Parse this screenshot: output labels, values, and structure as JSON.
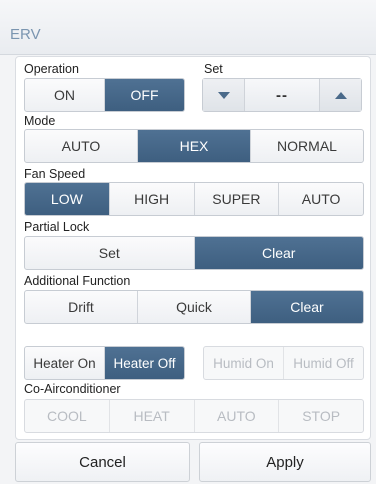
{
  "window": {
    "title": "ERV"
  },
  "operation": {
    "label": "Operation",
    "options": [
      "ON",
      "OFF"
    ],
    "selected": "OFF"
  },
  "set": {
    "label": "Set",
    "value": "--",
    "down_icon": "triangle-down-icon",
    "up_icon": "triangle-up-icon"
  },
  "mode": {
    "label": "Mode",
    "options": [
      "AUTO",
      "HEX",
      "NORMAL"
    ],
    "selected": "HEX"
  },
  "fan_speed": {
    "label": "Fan Speed",
    "options": [
      "LOW",
      "HIGH",
      "SUPER",
      "AUTO"
    ],
    "selected": "LOW"
  },
  "partial_lock": {
    "label": "Partial Lock",
    "options": [
      "Set",
      "Clear"
    ],
    "selected": "Clear"
  },
  "additional_function": {
    "label": "Additional Function",
    "options": [
      "Drift",
      "Quick",
      "Clear"
    ],
    "selected": "Clear"
  },
  "heater": {
    "options": [
      "Heater On",
      "Heater Off"
    ],
    "selected": "Heater Off"
  },
  "humid": {
    "options": [
      "Humid On",
      "Humid Off"
    ],
    "enabled": false
  },
  "co_airconditioner": {
    "label": "Co-Airconditioner",
    "options": [
      "COOL",
      "HEAT",
      "AUTO",
      "STOP"
    ],
    "enabled": false
  },
  "footer": {
    "cancel_label": "Cancel",
    "apply_label": "Apply"
  },
  "colors": {
    "accent": "#45678a",
    "title_text": "#7a95b0",
    "panel_bg": "#ffffff"
  }
}
